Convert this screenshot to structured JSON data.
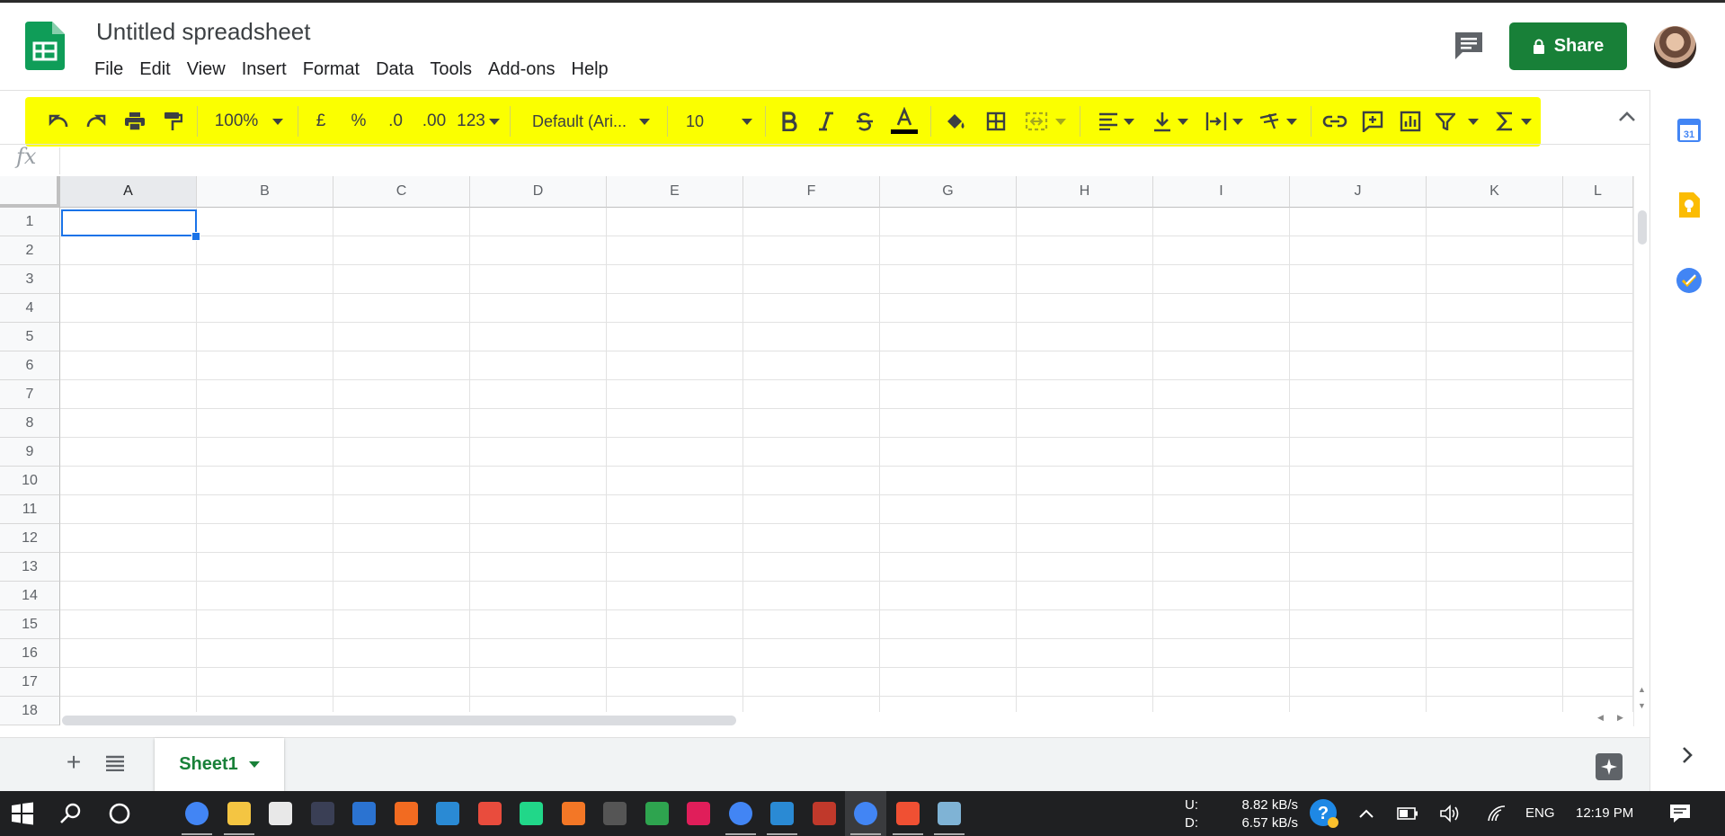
{
  "app": {
    "title": "Untitled spreadsheet",
    "menu": [
      "File",
      "Edit",
      "View",
      "Insert",
      "Format",
      "Data",
      "Tools",
      "Add-ons",
      "Help"
    ],
    "share_label": "Share",
    "brand_color": "#188038",
    "toolbar_highlight_color": "#fbff00"
  },
  "toolbar": {
    "zoom": "100%",
    "currency": "£",
    "percent": "%",
    "decrease_decimal": ".0",
    "increase_decimal": ".00",
    "more_formats": "123",
    "font": "Default (Ari...",
    "font_size": "10",
    "icons": [
      "undo-icon",
      "redo-icon",
      "print-icon",
      "paint-format-icon",
      "bold-icon",
      "italic-icon",
      "strikethrough-icon",
      "text-color-icon",
      "fill-color-icon",
      "borders-icon",
      "merge-cells-icon",
      "horizontal-align-icon",
      "vertical-align-icon",
      "text-wrap-icon",
      "text-rotate-icon",
      "link-icon",
      "comment-icon",
      "chart-icon",
      "filter-icon",
      "functions-icon"
    ]
  },
  "formula_bar": {
    "label": "fx",
    "value": ""
  },
  "grid": {
    "columns": [
      "A",
      "B",
      "C",
      "D",
      "E",
      "F",
      "G",
      "H",
      "I",
      "J",
      "K",
      "L"
    ],
    "rows": [
      "1",
      "2",
      "3",
      "4",
      "5",
      "6",
      "7",
      "8",
      "9",
      "10",
      "11",
      "12",
      "13",
      "14",
      "15",
      "16",
      "17",
      "18"
    ],
    "selected_cell": "A1"
  },
  "sheets": {
    "tabs": [
      "Sheet1"
    ],
    "active": "Sheet1"
  },
  "side_panel": {
    "icons": [
      "calendar-icon",
      "keep-icon",
      "tasks-icon"
    ],
    "calendar_day": "31"
  },
  "taskbar": {
    "apps": [
      "chrome",
      "file-explorer",
      "store",
      "app-dark",
      "virtualbox",
      "xampp",
      "vscode",
      "app-squares",
      "pycharm",
      "jupyter",
      "terminal",
      "app-green",
      "slack",
      "chrome-2",
      "vscode-2",
      "app-bird",
      "chrome-3",
      "git",
      "notepad"
    ],
    "net_up_label": "U:",
    "net_up": "8.82 kB/s",
    "net_down_label": "D:",
    "net_down": "6.57 kB/s",
    "language": "ENG",
    "time": "12:19 PM"
  }
}
